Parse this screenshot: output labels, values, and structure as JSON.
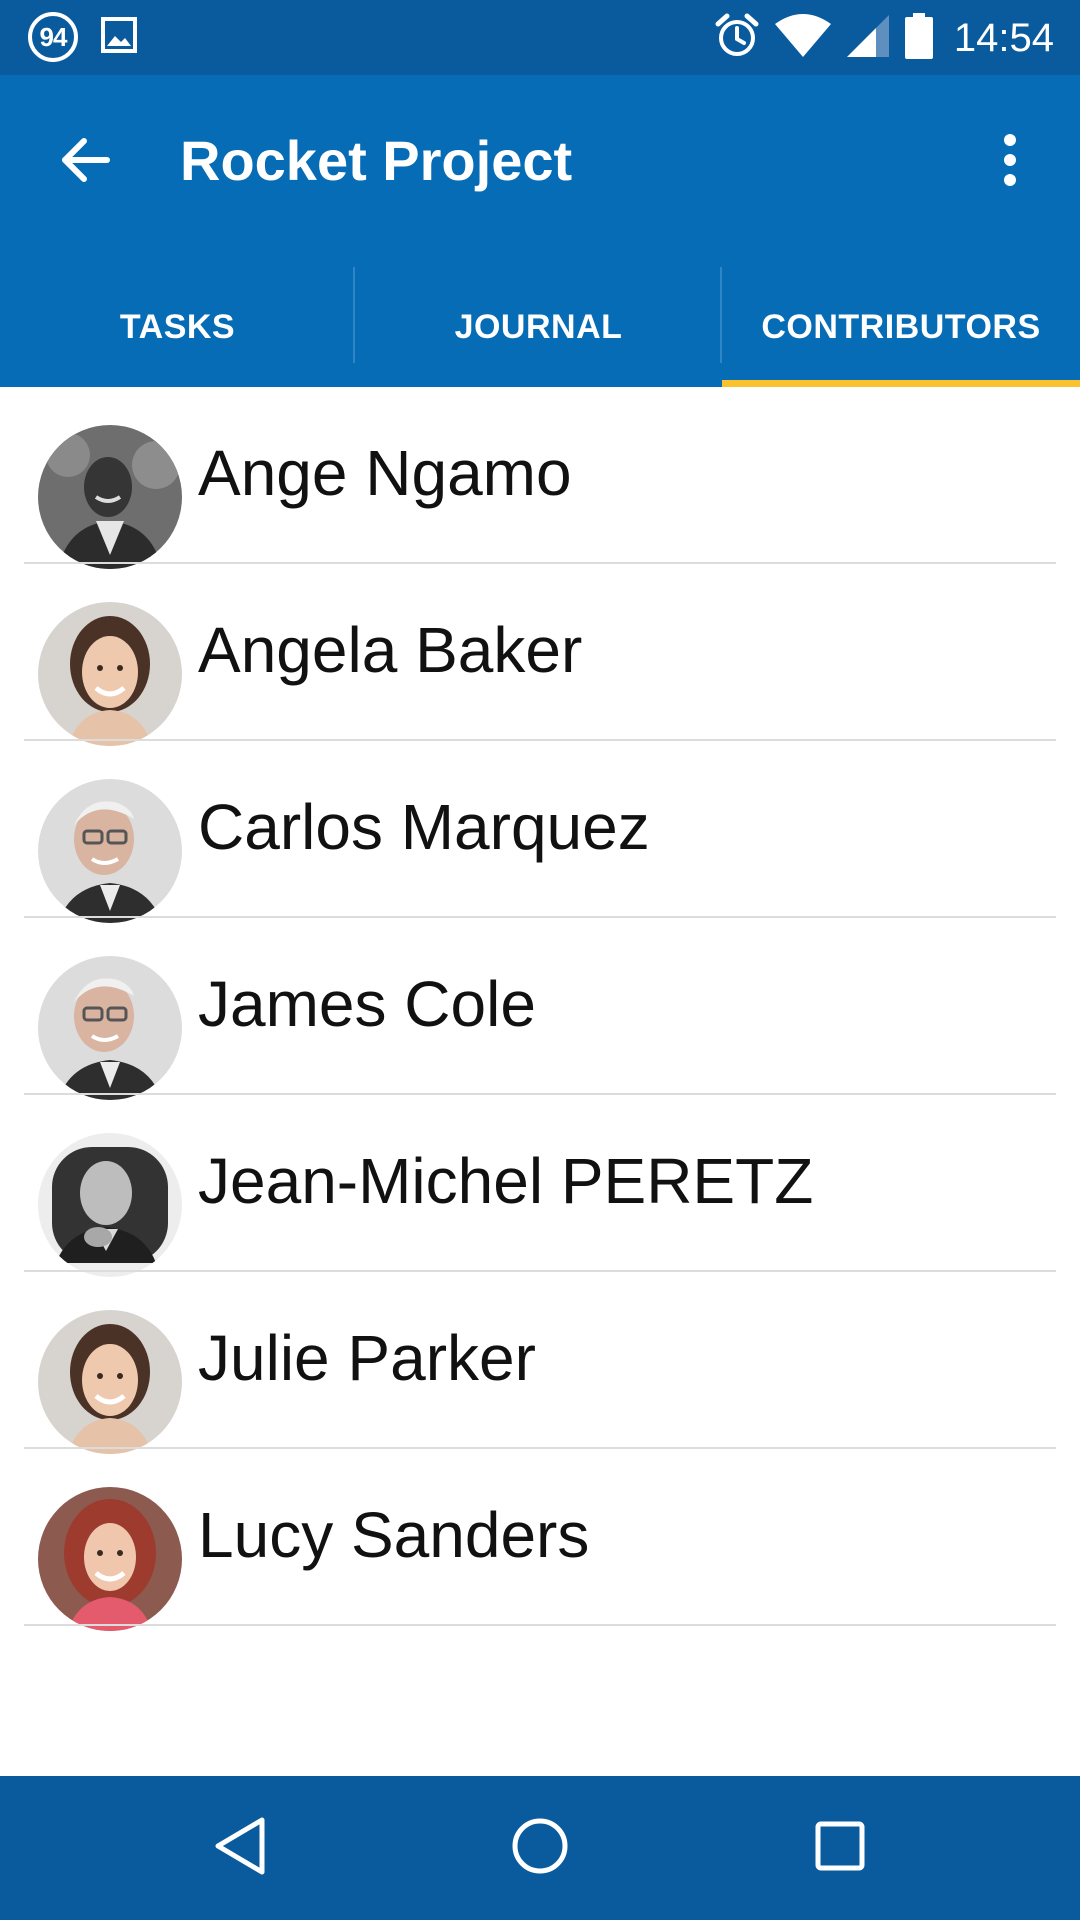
{
  "status_bar": {
    "notification_count": "94",
    "time": "14:54",
    "icons": [
      "notification-count-icon",
      "image-icon",
      "alarm-icon",
      "wifi-icon",
      "signal-icon",
      "battery-icon"
    ]
  },
  "app_bar": {
    "title": "Rocket Project",
    "back_icon": "arrow-back-icon",
    "overflow_icon": "more-vert-icon"
  },
  "tabs": [
    {
      "label": "TASKS",
      "selected": false
    },
    {
      "label": "JOURNAL",
      "selected": false
    },
    {
      "label": "CONTRIBUTORS",
      "selected": true
    }
  ],
  "contributors": [
    {
      "name": "Ange Ngamo"
    },
    {
      "name": "Angela Baker"
    },
    {
      "name": "Carlos Marquez"
    },
    {
      "name": "James Cole"
    },
    {
      "name": "Jean-Michel PERETZ"
    },
    {
      "name": "Julie Parker"
    },
    {
      "name": "Lucy Sanders"
    }
  ],
  "nav_bar": {
    "icons": [
      "back-triangle-icon",
      "home-circle-icon",
      "recents-square-icon"
    ]
  },
  "colors": {
    "status_bar": "#0a5b9e",
    "app_bar": "#066cb5",
    "tab_indicator": "#fbc22f",
    "nav_bar": "#0a5b9e"
  }
}
